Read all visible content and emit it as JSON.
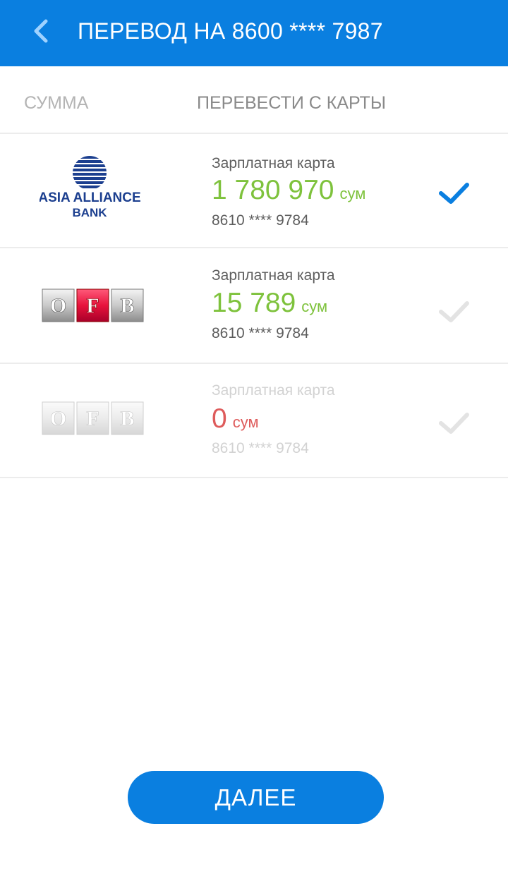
{
  "header": {
    "title": "ПЕРЕВОД НА 8600 **** 7987",
    "back_icon": "chevron-left-icon"
  },
  "tabs": [
    {
      "label": "СУММА"
    },
    {
      "label": "ПЕРЕВЕСТИ С КАРТЫ"
    }
  ],
  "cards": [
    {
      "bank": "ASIA ALLIANCE BANK",
      "logo_line1": "ASIA ALLIANCE",
      "logo_line2": "BANK",
      "name": "Зарплатная карта",
      "balance": "1 780 970",
      "currency": "сум",
      "number": "8610 **** 9784",
      "selected": true,
      "enabled": true
    },
    {
      "bank": "OFB",
      "logo_letters": [
        "O",
        "F",
        "B"
      ],
      "name": "Зарплатная карта",
      "balance": "15 789",
      "currency": "сум",
      "number": "8610 **** 9784",
      "selected": false,
      "enabled": true
    },
    {
      "bank": "OFB",
      "logo_letters": [
        "O",
        "F",
        "B"
      ],
      "name": "Зарплатная карта",
      "balance": "0",
      "currency": "сум",
      "number": "8610 **** 9784",
      "selected": false,
      "enabled": false
    }
  ],
  "next_button": {
    "label": "ДАЛЕЕ"
  },
  "colors": {
    "primary": "#0a7fe0",
    "balance_positive": "#7ec23c",
    "balance_zero": "#de5b5b",
    "check_inactive": "#e3e3e3",
    "ofb_red": "#e8123c"
  }
}
